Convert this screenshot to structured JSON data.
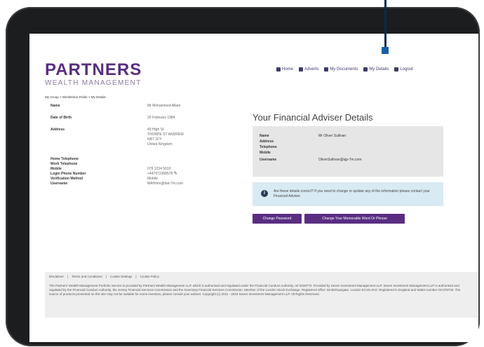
{
  "brand": {
    "name": "PARTNERS",
    "tagline": "WEALTH MANAGEMENT",
    "color": "#5a2d82"
  },
  "nav": [
    {
      "label": "Home",
      "icon": "home-icon"
    },
    {
      "label": "Adverts",
      "icon": "megaphone-icon"
    },
    {
      "label": "My Documents",
      "icon": "documents-icon"
    },
    {
      "label": "My Details",
      "icon": "user-icon"
    },
    {
      "label": "Logout",
      "icon": "logout-icon"
    }
  ],
  "breadcrumb": "My Group > Wimbledon Fields > My Details",
  "client": {
    "name_label": "Name",
    "name_value": "Mr Mohammed Allam",
    "dob_label": "Date of Birth",
    "dob_value": "29 February 1984",
    "address_label": "Address",
    "address_lines": [
      "49 High St",
      "THORPE ST ANDREW",
      "NR7 1FY",
      "United Kingdom"
    ],
    "home_tel_label": "Home Telephone",
    "work_tel_label": "Work Telephone",
    "mobile_label": "Mobile",
    "mobile_value": "079 1234 5019",
    "login_phone_label": "Login Phone Number",
    "login_phone_value": "+447972368578",
    "verification_label": "Verification Method",
    "verification_value": "Mobile",
    "username_label": "Username",
    "username_value": "MAHmm@dat-7m.com"
  },
  "adviser": {
    "title": "Your Financial Adviser Details",
    "name_label": "Name",
    "name_value": "Mr Oliver Sullivan",
    "address_label": "Address",
    "telephone_label": "Telephone",
    "mobile_label": "Mobile",
    "username_label": "Username",
    "username_value": "OliverSullivan@sjp-7m.com"
  },
  "info": {
    "icon": "info-icon",
    "text": "Are these details correct? If you need to change or update any of the information please contact your Financial Adviser."
  },
  "buttons": {
    "change_password": "Change Password",
    "change_memorable": "Change Your Memorable Word Or Phrase"
  },
  "footer": {
    "links": [
      "Disclaimer",
      "Terms and Conditions",
      "Cookie Settings",
      "Cookie Policy"
    ],
    "text": "The Partners' Wealth Management Portfolio Service is provided by Partners Wealth Management LLP, which is authorised and regulated under the Financial Conduct Authority, ref 0228770. Provided by Seven Investment Management LLP. Seven Investment Management LLP is authorised and regulated by the Financial Conduct Authority, the Jersey Financial Services Commission and the Guernsey Financial Services Commission. Member of the London Stock Exchange. Registered office: 55 Bishopsgate, London EC2N 3AS. Registered in England and Wales number OC378740. The source of products presented on this site may not be suitable for some investors, please consult your adviser. Copyright (c) 2011 - 2019 Seven Investment Management LLP. All Rights Reserved."
  }
}
